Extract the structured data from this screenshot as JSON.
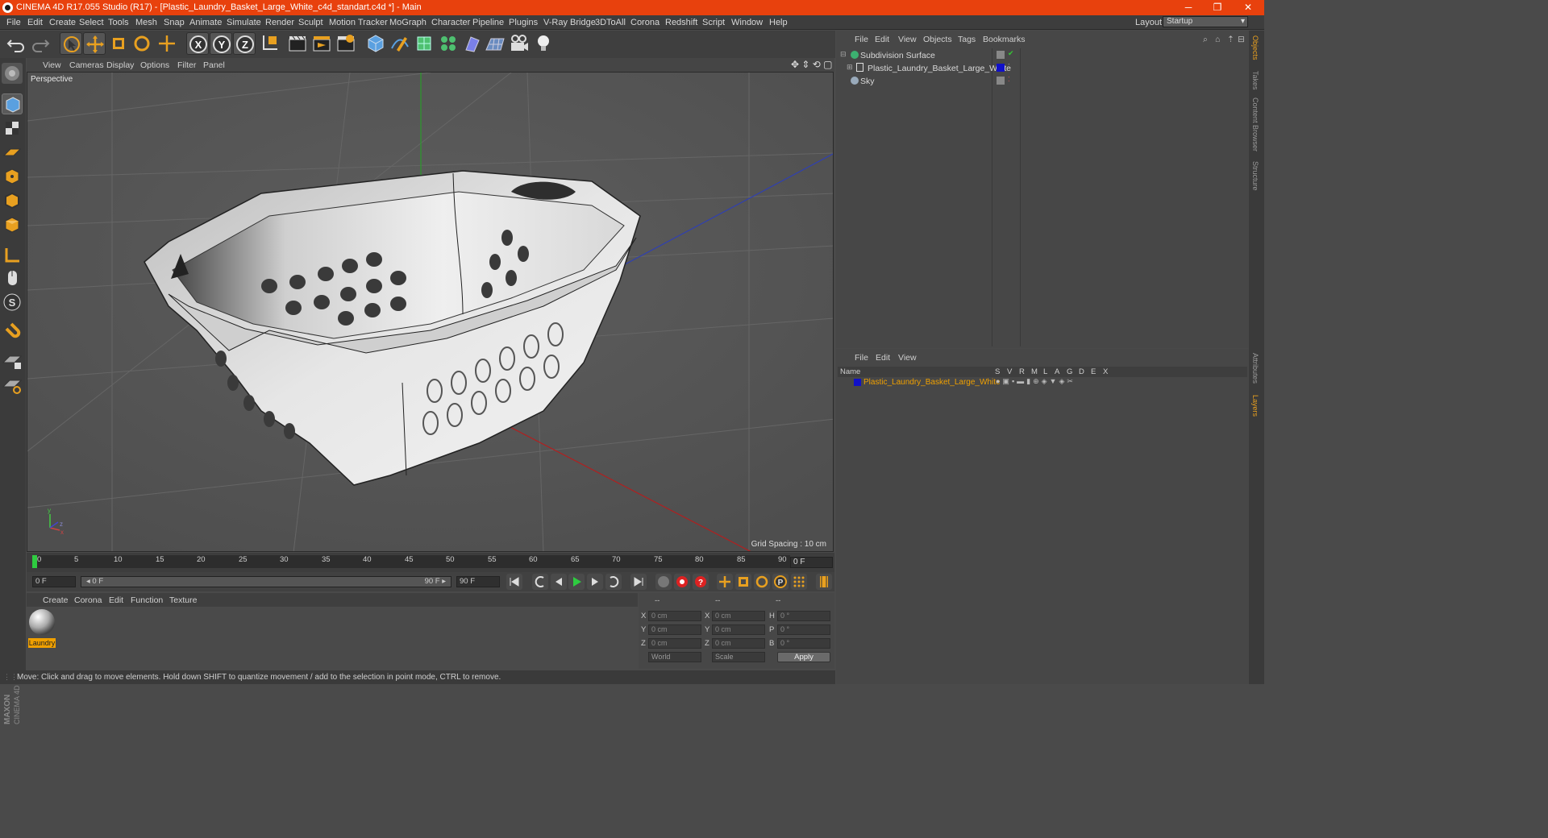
{
  "window": {
    "title": "CINEMA 4D R17.055 Studio (R17) - [Plastic_Laundry_Basket_Large_White_c4d_standart.c4d *] - Main",
    "controls": [
      "─",
      "❐",
      "✕"
    ]
  },
  "menubar": {
    "items": [
      "File",
      "Edit",
      "Create",
      "Select",
      "Tools",
      "Mesh",
      "Snap",
      "Animate",
      "Simulate",
      "Render",
      "Sculpt",
      "Motion Tracker",
      "MoGraph",
      "Character",
      "Pipeline",
      "Plugins",
      "V-Ray Bridge",
      "3DToAll",
      "Corona",
      "Redshift",
      "Script",
      "Window",
      "Help"
    ],
    "layout_label": "Layout:",
    "layout_value": "Startup"
  },
  "viewport": {
    "menu": [
      "View",
      "Cameras",
      "Display",
      "Options",
      "Filter",
      "Panel"
    ],
    "label": "Perspective",
    "grid_spacing": "Grid Spacing : 10 cm"
  },
  "timeline": {
    "ticks": [
      "0",
      "5",
      "10",
      "15",
      "20",
      "25",
      "30",
      "35",
      "40",
      "45",
      "50",
      "55",
      "60",
      "65",
      "70",
      "75",
      "80",
      "85",
      "90"
    ],
    "current_frame": "0 F",
    "start_field": "0 F",
    "range_start": "◂ 0 F",
    "range_end": "90 F ▸",
    "end_field": "90 F"
  },
  "material_manager": {
    "menu": [
      "Create",
      "Corona",
      "Edit",
      "Function",
      "Texture"
    ],
    "materials": [
      {
        "name": "Laundry"
      }
    ]
  },
  "coordinates": {
    "headers": [
      "--",
      "--",
      "--"
    ],
    "rows": [
      {
        "a": "X",
        "av": "0 cm",
        "b": "X",
        "bv": "0 cm",
        "c": "H",
        "cv": "0 °"
      },
      {
        "a": "Y",
        "av": "0 cm",
        "b": "Y",
        "bv": "0 cm",
        "c": "P",
        "cv": "0 °"
      },
      {
        "a": "Z",
        "av": "0 cm",
        "b": "Z",
        "bv": "0 cm",
        "c": "B",
        "cv": "0 °"
      }
    ],
    "mode": "World",
    "scale": "Scale",
    "apply": "Apply"
  },
  "status": "Move: Click and drag to move elements. Hold down SHIFT to quantize movement / add to the selection in point mode, CTRL to remove.",
  "object_manager": {
    "menu": [
      "File",
      "Edit",
      "View",
      "Objects",
      "Tags",
      "Bookmarks"
    ],
    "objects": [
      {
        "name": "Subdivision Surface"
      },
      {
        "name": "Plastic_Laundry_Basket_Large_White"
      },
      {
        "name": "Sky"
      }
    ]
  },
  "layer_manager": {
    "menu": [
      "File",
      "Edit",
      "View"
    ],
    "columns": [
      "Name",
      "S",
      "V",
      "R",
      "M",
      "L",
      "A",
      "G",
      "D",
      "E",
      "X"
    ],
    "layers": [
      {
        "name": "Plastic_Laundry_Basket_Large_White",
        "color": "#1010c8"
      }
    ]
  },
  "side_tabs": [
    "Objects",
    "Takes",
    "Content Browser",
    "Structure",
    "Attributes",
    "Layers"
  ],
  "brand": {
    "logo_text": "MAXON CINEMA 4D"
  },
  "colors": {
    "title_bar": "#e8410d",
    "selection": "#f0a000",
    "layer_color": "#1010c8"
  }
}
